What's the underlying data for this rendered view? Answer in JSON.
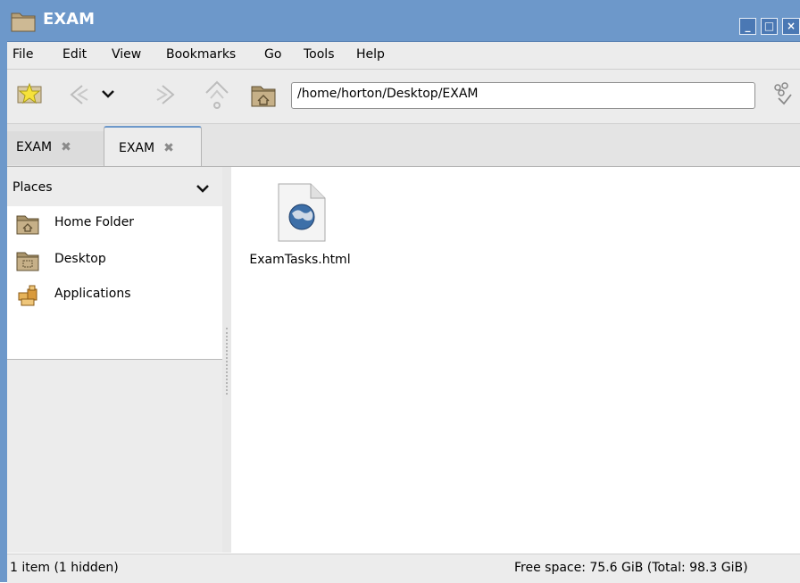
{
  "window": {
    "title": "EXAM",
    "buttons": [
      "minimize",
      "maximize",
      "close"
    ]
  },
  "menubar": {
    "items": [
      {
        "label": "File"
      },
      {
        "label": "Edit"
      },
      {
        "label": "View"
      },
      {
        "label": "Bookmarks"
      },
      {
        "label": "Go"
      },
      {
        "label": "Tools"
      },
      {
        "label": "Help"
      }
    ]
  },
  "toolbar": {
    "location": "/home/horton/Desktop/EXAM",
    "icons": [
      "bookmark-star-icon",
      "back-icon",
      "history-dropdown-icon",
      "forward-icon",
      "up-icon",
      "home-folder-icon",
      "location-toggle-icon"
    ]
  },
  "tabs": [
    {
      "label": "EXAM",
      "active": false
    },
    {
      "label": "EXAM",
      "active": true
    }
  ],
  "sidebar": {
    "header": "Places",
    "items": [
      {
        "label": "Home Folder",
        "icon": "home-folder-icon"
      },
      {
        "label": "Desktop",
        "icon": "desktop-folder-icon"
      },
      {
        "label": "Applications",
        "icon": "applications-icon"
      }
    ]
  },
  "main": {
    "files": [
      {
        "name": "ExamTasks.html",
        "icon": "html-document-icon"
      }
    ]
  },
  "statusbar": {
    "left": "1 item (1 hidden)",
    "right": "Free space: 75.6 GiB (Total: 98.3 GiB)"
  },
  "colors": {
    "titlebar": "#6d98ca",
    "chrome": "#ececec"
  }
}
